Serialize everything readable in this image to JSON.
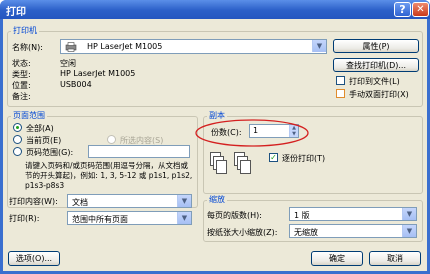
{
  "window": {
    "title": "打印",
    "help_icon": "?",
    "close_icon": "✕"
  },
  "printer": {
    "group_title": "打印机",
    "name_label": "名称(N):",
    "name_value": "HP LaserJet M1005",
    "status_label": "状态:",
    "status_value": "空闲",
    "type_label": "类型:",
    "type_value": "HP LaserJet M1005",
    "location_label": "位置:",
    "location_value": "USB004",
    "comment_label": "备注:",
    "comment_value": "",
    "properties_button": "属性(P)",
    "find_printer_button": "查找打印机(D)...",
    "print_to_file_label": "打印到文件(L)",
    "manual_duplex_label": "手动双面打印(X)"
  },
  "page_range": {
    "group_title": "页面范围",
    "all_label": "全部(A)",
    "current_label": "当前页(E)",
    "selection_label": "所选内容(S)",
    "pages_label": "页码范围(G):",
    "hint": "请键入页码和/或页码范围(用逗号分隔，从文档或节的开头算起)，例如: 1, 3, 5-12 或 p1s1, p1s2, p1s3-p8s3"
  },
  "copies": {
    "group_title": "副本",
    "count_label": "份数(C):",
    "count_value": "1",
    "collate_label": "逐份打印(T)",
    "collate_checked": true
  },
  "print_what": {
    "label": "打印内容(W):",
    "value": "文档"
  },
  "print_which": {
    "label": "打印(R):",
    "value": "范围中所有页面"
  },
  "zoom": {
    "group_title": "缩放",
    "pages_per_sheet_label": "每页的版数(H):",
    "pages_per_sheet_value": "1 版",
    "scale_label": "按纸张大小缩放(Z):",
    "scale_value": "无缩放"
  },
  "footer": {
    "options_button": "选项(O)...",
    "ok_button": "确定",
    "cancel_button": "取消"
  },
  "colors": {
    "highlight_circle": "#d42020",
    "title_blue": "#0046d5"
  }
}
